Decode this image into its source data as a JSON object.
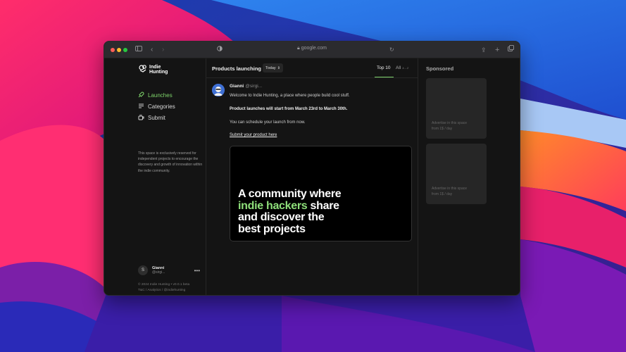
{
  "browser": {
    "url": "google.com"
  },
  "sidebar": {
    "logo_line1": "Indie",
    "logo_line2": "Hunting",
    "nav": [
      {
        "label": "Launches",
        "icon": "rocket-icon",
        "active": true
      },
      {
        "label": "Categories",
        "icon": "list-icon",
        "active": false
      },
      {
        "label": "Submit",
        "icon": "cup-icon",
        "active": false
      }
    ],
    "description": "This space is exclusively reserved for independent projects to encourage the discovery and growth of innovation within the indie community.",
    "profile": {
      "initial": "S",
      "name": "Gianni",
      "handle": "@sirgi..."
    },
    "footer_line1": "© 2024 Indie Hunting • v0.0.1 beta",
    "footer_line2": "T&C / Analytics / @indiehunting"
  },
  "main": {
    "title": "Products launching",
    "filter": "Today",
    "tab_top": "Top 10",
    "tab_all": "All",
    "tab_all_sub": "A→Z",
    "post": {
      "author": "Gianni",
      "handle": "@sirgi...",
      "line1": "Welcome to Indie Hunting, a place where people build cool stuff.",
      "line2": "Product launches will start from March 23rd to March 30th.",
      "line3": "You can schedule your launch from now.",
      "link": "Submit your product here"
    },
    "banner": {
      "line1": "A community where",
      "line2_green": "indie hackers",
      "line2_rest": " share",
      "line3": "and discover the",
      "line4": "best projects"
    }
  },
  "sponsored": {
    "title": "Sponsored",
    "ads": [
      {
        "line1": "Advertise in this space",
        "line2": "from 1$ / day"
      },
      {
        "line1": "Advertise in this space",
        "line2": "from 1$ / day"
      }
    ]
  },
  "colors": {
    "accent": "#7ed36a",
    "background": "#141414"
  }
}
